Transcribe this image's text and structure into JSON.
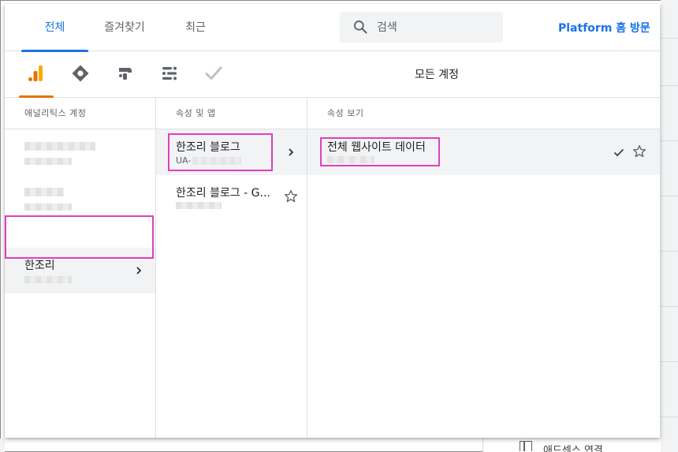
{
  "header": {
    "tabs": [
      {
        "label": "전체",
        "active": true
      },
      {
        "label": "즐겨찾기",
        "active": false
      },
      {
        "label": "최근",
        "active": false
      }
    ],
    "search_placeholder": "검색",
    "platform_link": "Platform 홈 방문"
  },
  "products": {
    "icons": [
      "analytics-icon",
      "tag-manager-icon",
      "optimize-icon",
      "data-studio-icon",
      "surveys-icon"
    ],
    "active_index": 0,
    "all_accounts": "모든 계정"
  },
  "columns": {
    "accounts": {
      "header": "애널리틱스 계정",
      "items": [
        {
          "name": "",
          "blurred": true
        },
        {
          "name": "",
          "blurred": true
        },
        {
          "name": "한조리",
          "sub": "",
          "selected": true
        }
      ]
    },
    "properties": {
      "header": "속성 및 앱",
      "items": [
        {
          "name": "한조리 블로그",
          "sub": "UA-",
          "selected": true
        },
        {
          "name": "한조리 블로그 - G...",
          "sub": ""
        }
      ]
    },
    "views": {
      "header": "속성 보기",
      "items": [
        {
          "name": "전체 웹사이트 데이터",
          "sub": "",
          "selected": true,
          "checked": true
        }
      ]
    }
  },
  "background": {
    "bottom_link": "애드센스 연결"
  },
  "colors": {
    "accent": "#1a73e8",
    "analytics": "#e37400",
    "highlight": "#e040c0"
  }
}
